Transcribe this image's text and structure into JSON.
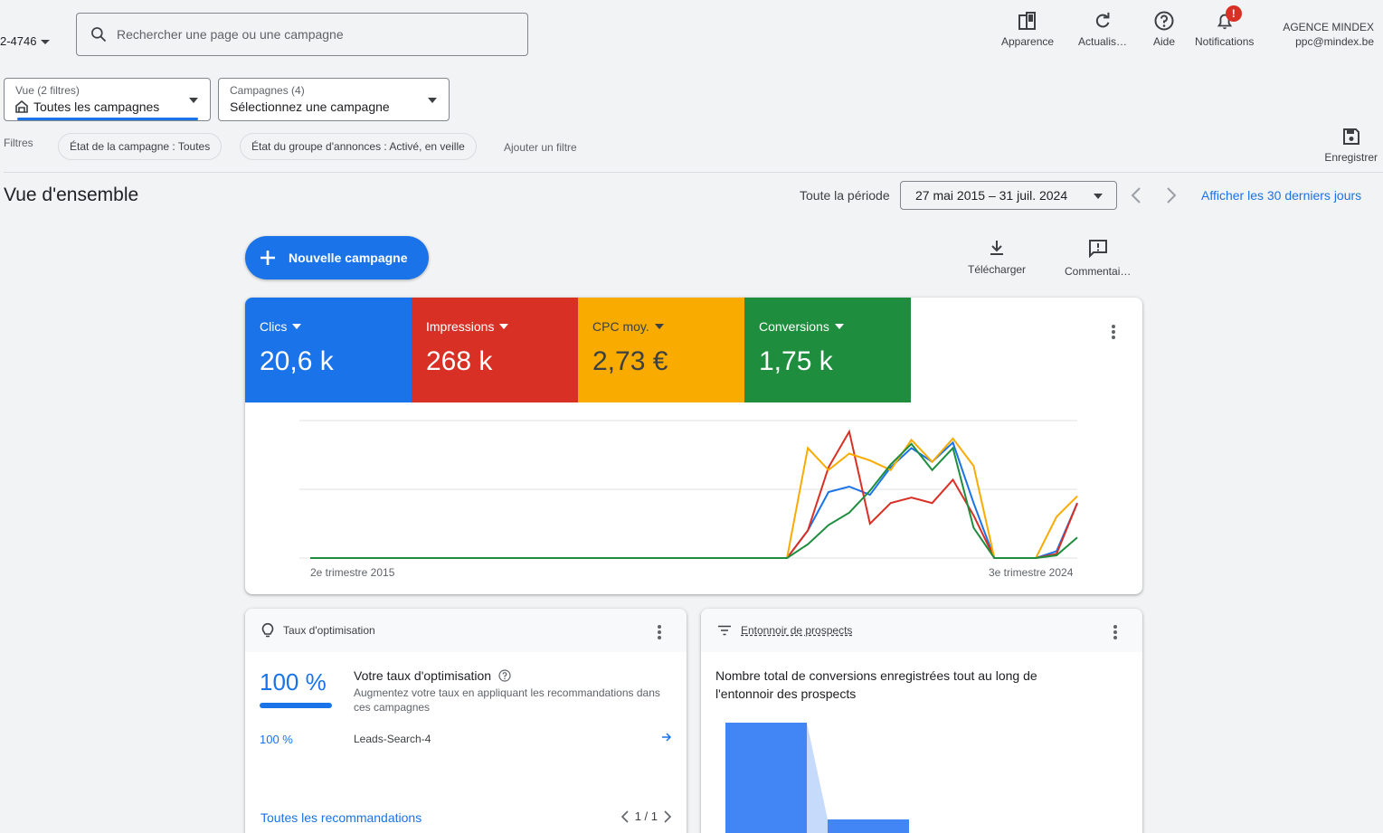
{
  "header": {
    "account_id": "2-4746",
    "search_placeholder": "Rechercher une page ou une campagne",
    "buttons": {
      "appearance": "Apparence",
      "refresh": "Actualis…",
      "help": "Aide",
      "notifications": "Notifications"
    },
    "notification_badge": "!",
    "user": {
      "org": "AGENCE MINDEX",
      "email": "ppc@mindex.be"
    }
  },
  "view_selector": {
    "label": "Vue (2 filtres)",
    "value": "Toutes les campagnes"
  },
  "campaign_selector": {
    "label": "Campagnes (4)",
    "value": "Sélectionnez une campagne"
  },
  "filters": {
    "label": "Filtres",
    "chips": [
      "État de la campagne : Toutes",
      "État du groupe d'annonces : Activé, en veille"
    ],
    "add": "Ajouter un filtre",
    "save": "Enregistrer"
  },
  "overview": {
    "title": "Vue d'ensemble",
    "period_label": "Toute la période",
    "date_range": "27 mai 2015 – 31 juil. 2024",
    "last30": "Afficher les 30 derniers jours"
  },
  "toolbar": {
    "new_campaign": "Nouvelle campagne",
    "download": "Télécharger",
    "comments": "Commentai…"
  },
  "metrics": [
    {
      "label": "Clics",
      "value": "20,6 k",
      "color": "#1a73e8"
    },
    {
      "label": "Impressions",
      "value": "268 k",
      "color": "#d93025"
    },
    {
      "label": "CPC moy.",
      "value": "2,73 €",
      "color": "#f9ab00"
    },
    {
      "label": "Conversions",
      "value": "1,75 k",
      "color": "#1e8e3e"
    }
  ],
  "chart_data": {
    "type": "line",
    "x_start_label": "2e trimestre 2015",
    "x_end_label": "3e trimestre 2024",
    "grid": true,
    "y_range_normalized": [
      0,
      1
    ],
    "series": [
      {
        "name": "Clics",
        "color": "#1a73e8",
        "values": [
          0,
          0,
          0,
          0,
          0,
          0,
          0,
          0,
          0,
          0,
          0,
          0,
          0,
          0,
          0,
          0,
          0,
          0,
          0,
          0,
          0,
          0,
          0,
          0,
          0.2,
          0.48,
          0.52,
          0.46,
          0.66,
          0.8,
          0.7,
          0.84,
          0.4,
          0,
          0,
          0,
          0.05,
          0.4
        ]
      },
      {
        "name": "Impressions",
        "color": "#d93025",
        "values": [
          0,
          0,
          0,
          0,
          0,
          0,
          0,
          0,
          0,
          0,
          0,
          0,
          0,
          0,
          0,
          0,
          0,
          0,
          0,
          0,
          0,
          0,
          0,
          0,
          0.2,
          0.66,
          0.92,
          0.25,
          0.4,
          0.44,
          0.4,
          0.57,
          0.31,
          0,
          0,
          0,
          0.03,
          0.4
        ]
      },
      {
        "name": "CPC moy.",
        "color": "#f9ab00",
        "values": [
          0,
          0,
          0,
          0,
          0,
          0,
          0,
          0,
          0,
          0,
          0,
          0,
          0,
          0,
          0,
          0,
          0,
          0,
          0,
          0,
          0,
          0,
          0,
          0,
          0.8,
          0.64,
          0.76,
          0.71,
          0.64,
          0.86,
          0.7,
          0.87,
          0.67,
          0,
          0,
          0,
          0.3,
          0.45
        ]
      },
      {
        "name": "Conversions",
        "color": "#1e8e3e",
        "values": [
          0,
          0,
          0,
          0,
          0,
          0,
          0,
          0,
          0,
          0,
          0,
          0,
          0,
          0,
          0,
          0,
          0,
          0,
          0,
          0,
          0,
          0,
          0,
          0,
          0.1,
          0.24,
          0.33,
          0.49,
          0.68,
          0.83,
          0.64,
          0.8,
          0.22,
          0,
          0,
          0,
          0.02,
          0.15
        ]
      }
    ]
  },
  "optimization": {
    "header": "Taux d'optimisation",
    "score": "100 %",
    "title": "Votre taux d'optimisation",
    "description": "Augmentez votre taux en appliquant les recommandations dans ces campagnes",
    "row": {
      "pct": "100 %",
      "name": "Leads-Search-4"
    },
    "all_link": "Toutes les recommandations",
    "pager": "1 / 1"
  },
  "funnel": {
    "header": "Entonnoir de prospects",
    "title": "Nombre total de conversions enregistrées tout au long de l'entonnoir des prospects"
  }
}
